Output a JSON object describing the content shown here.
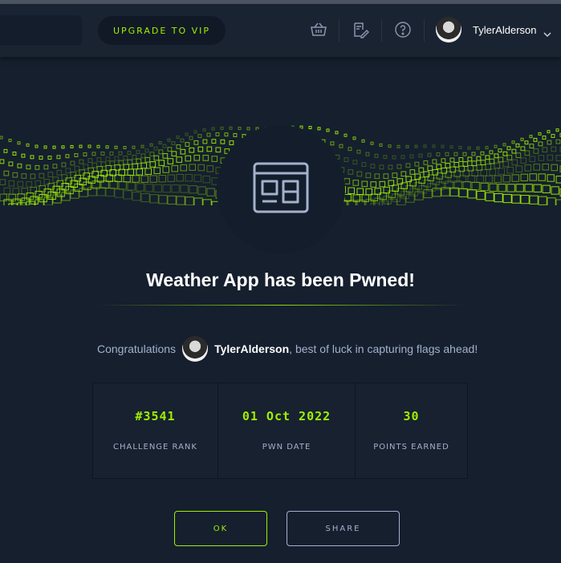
{
  "topbar": {
    "vip_label": "UPGRADE TO VIP",
    "user_name": "TylerAlderson"
  },
  "modal": {
    "title": "Weather App has been Pwned!",
    "congrats_prefix": "Congratulations",
    "user_name": "TylerAlderson",
    "congrats_suffix": ", best of luck in capturing flags ahead!",
    "stats": [
      {
        "value": "#3541",
        "label": "CHALLENGE RANK"
      },
      {
        "value": "01 Oct 2022",
        "label": "PWN DATE"
      },
      {
        "value": "30",
        "label": "POINTS EARNED"
      }
    ],
    "ok_label": "OK",
    "share_label": "SHARE"
  },
  "colors": {
    "accent": "#9fef00",
    "background": "#151f2e",
    "topbar": "#1a2332",
    "muted_text": "#a4b1cd"
  },
  "icons": [
    "basket-icon",
    "receipt-edit-icon",
    "help-icon",
    "chevron-down-icon",
    "webapp-icon"
  ]
}
